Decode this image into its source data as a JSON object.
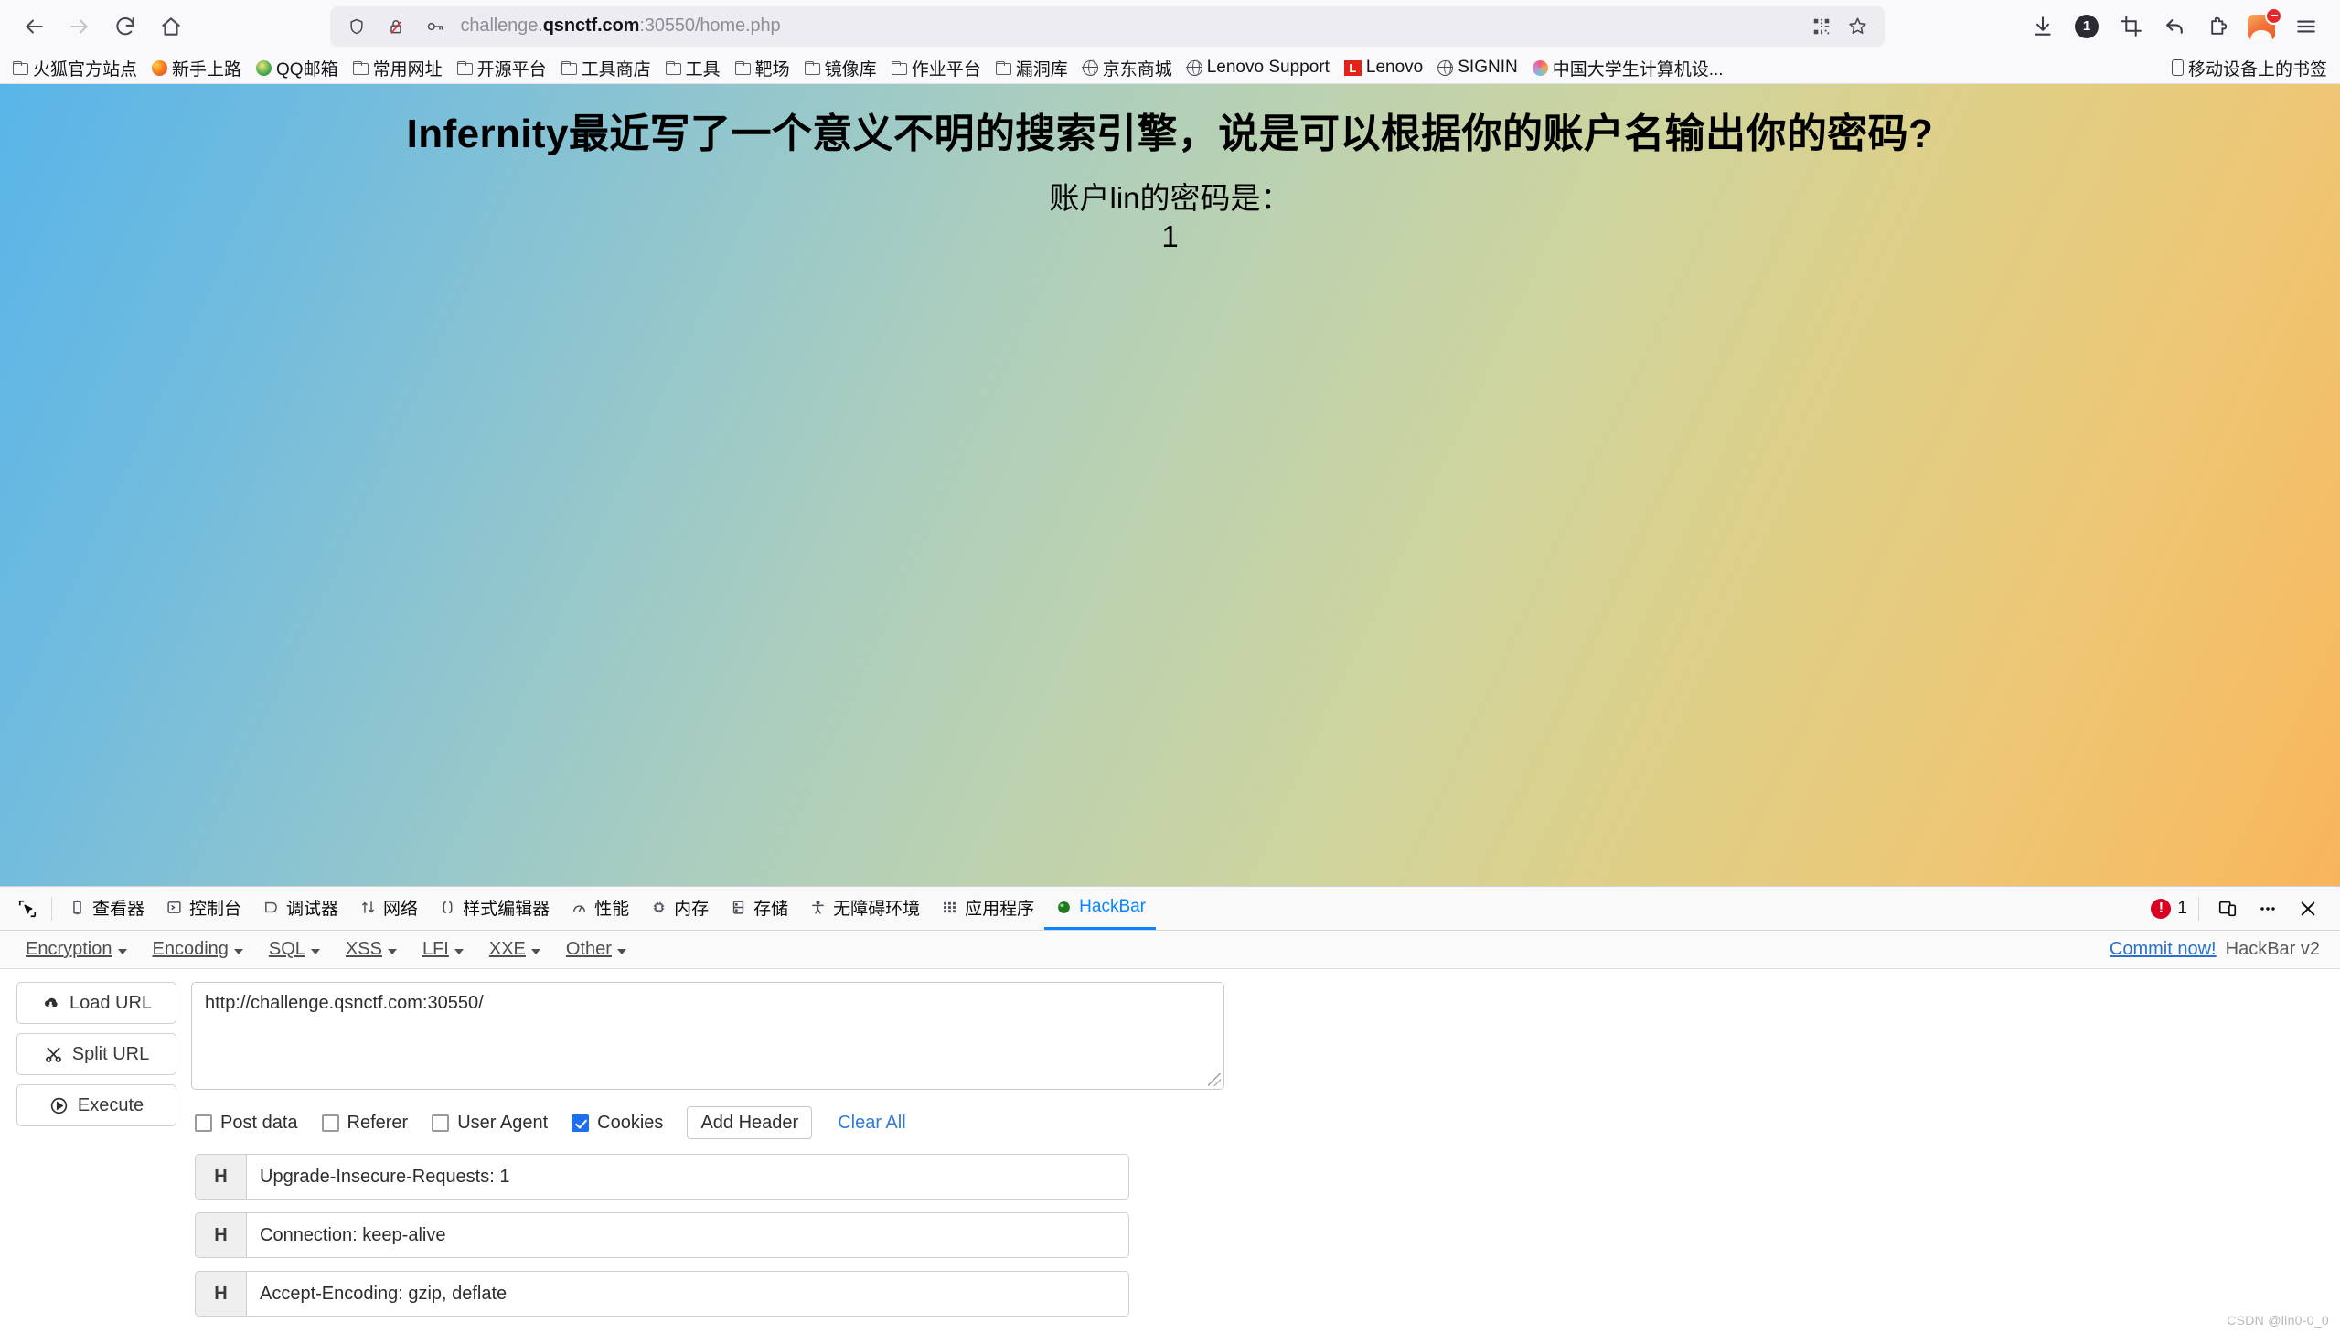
{
  "browser": {
    "nav": {
      "back": "back-arrow",
      "forward": "forward-arrow",
      "reload": "reload",
      "home": "home"
    },
    "url_prefix": "challenge.",
    "url_host": "qsnctf.com",
    "url_suffix": ":30550/home.php",
    "url_full": "challenge.qsnctf.com:30550/home.php",
    "toolbar_icons": [
      "download-icon",
      "notification-badge",
      "screenshot-icon",
      "undo-icon",
      "extensions-icon",
      "account-avatar",
      "menu-icon"
    ],
    "download_badge": "1"
  },
  "bookmarks": {
    "items": [
      {
        "label": "火狐官方站点",
        "icon": "folder-icon"
      },
      {
        "label": "新手上路",
        "icon": "firefox-icon"
      },
      {
        "label": "QQ邮箱",
        "icon": "qq-icon"
      },
      {
        "label": "常用网址",
        "icon": "folder-icon"
      },
      {
        "label": "开源平台",
        "icon": "folder-icon"
      },
      {
        "label": "工具商店",
        "icon": "folder-icon"
      },
      {
        "label": "工具",
        "icon": "folder-icon"
      },
      {
        "label": "靶场",
        "icon": "folder-icon"
      },
      {
        "label": "镜像库",
        "icon": "folder-icon"
      },
      {
        "label": "作业平台",
        "icon": "folder-icon"
      },
      {
        "label": "漏洞库",
        "icon": "folder-icon"
      },
      {
        "label": "京东商城",
        "icon": "globe-icon"
      },
      {
        "label": "Lenovo Support",
        "icon": "globe-icon"
      },
      {
        "label": "Lenovo",
        "icon": "lenovo-icon"
      },
      {
        "label": "SIGNIN",
        "icon": "globe-icon"
      },
      {
        "label": "中国大学生计算机设...",
        "icon": "flower-icon"
      }
    ],
    "mobile_bookmarks": "移动设备上的书签"
  },
  "page": {
    "heading": "Infernity最近写了一个意义不明的搜索引擎，说是可以根据你的账户名输出你的密码?",
    "line2": "账户lin的密码是：",
    "line3": "1",
    "watermark": "CSDN @lin0-0_0",
    "gradient_from": "#59b5e8",
    "gradient_to": "#f8b45c"
  },
  "devtools": {
    "tabs": [
      {
        "label": "查看器",
        "icon": "inspector-icon",
        "active": false
      },
      {
        "label": "控制台",
        "icon": "console-icon",
        "active": false
      },
      {
        "label": "调试器",
        "icon": "debugger-icon",
        "active": false
      },
      {
        "label": "网络",
        "icon": "network-icon",
        "active": false
      },
      {
        "label": "样式编辑器",
        "icon": "style-editor-icon",
        "active": false
      },
      {
        "label": "性能",
        "icon": "performance-icon",
        "active": false
      },
      {
        "label": "内存",
        "icon": "memory-icon",
        "active": false
      },
      {
        "label": "存储",
        "icon": "storage-icon",
        "active": false
      },
      {
        "label": "无障碍环境",
        "icon": "accessibility-icon",
        "active": false
      },
      {
        "label": "应用程序",
        "icon": "application-icon",
        "active": false
      },
      {
        "label": "HackBar",
        "icon": "hackbar-icon",
        "active": true
      }
    ],
    "error_count": "1",
    "right_icons": [
      "responsive-design-icon",
      "more-options-icon",
      "close-icon"
    ]
  },
  "hackbar": {
    "menus": [
      "Encryption",
      "Encoding",
      "SQL",
      "XSS",
      "LFI",
      "XXE",
      "Other"
    ],
    "commit_label": "Commit now!",
    "version_label": "HackBar v2",
    "actions": [
      {
        "label": "Load URL",
        "icon": "cloud-download-icon"
      },
      {
        "label": "Split URL",
        "icon": "scissors-icon"
      },
      {
        "label": "Execute",
        "icon": "play-circle-icon"
      }
    ],
    "url_value": "http://challenge.qsnctf.com:30550/",
    "options": [
      {
        "label": "Post data",
        "checked": false
      },
      {
        "label": "Referer",
        "checked": false
      },
      {
        "label": "User Agent",
        "checked": false
      },
      {
        "label": "Cookies",
        "checked": true
      }
    ],
    "add_header_label": "Add Header",
    "clear_all_label": "Clear All",
    "header_tag": "H",
    "headers": [
      "Upgrade-Insecure-Requests: 1",
      "Connection: keep-alive",
      "Accept-Encoding: gzip, deflate"
    ]
  }
}
